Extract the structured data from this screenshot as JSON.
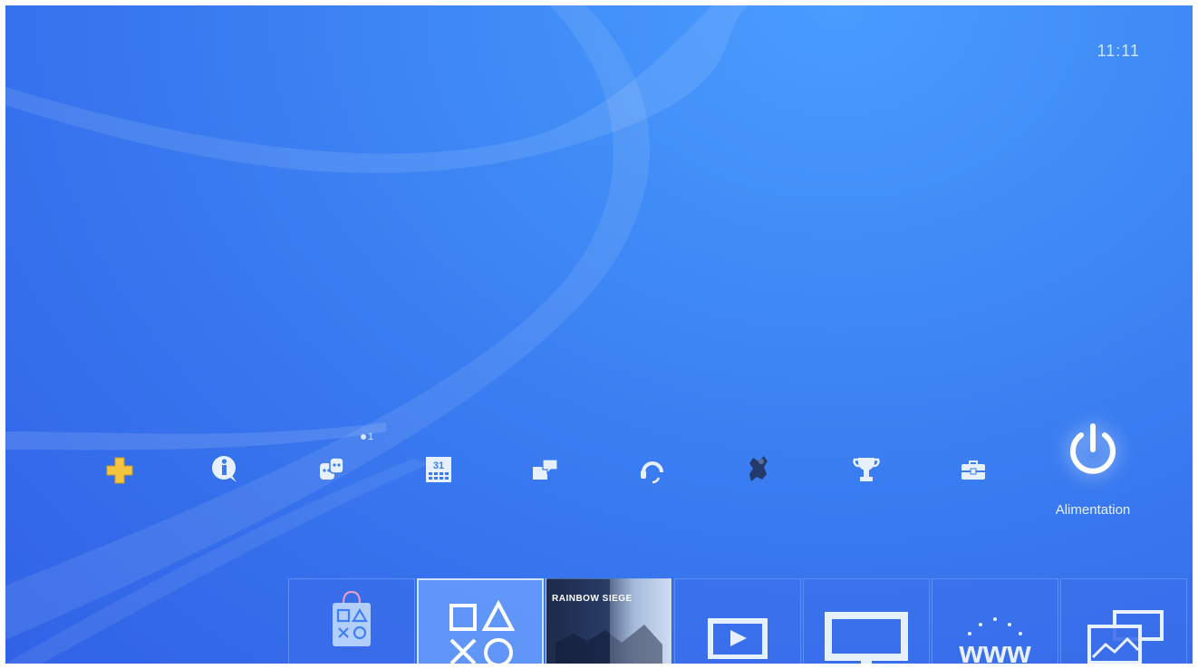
{
  "status": {
    "clock": "11:11"
  },
  "function_bar": {
    "items": [
      {
        "id": "playstation-plus",
        "icon": "ps-plus-icon"
      },
      {
        "id": "whats-new",
        "icon": "info-icon"
      },
      {
        "id": "friends",
        "icon": "friends-icon",
        "badge": "1"
      },
      {
        "id": "events",
        "icon": "calendar-icon",
        "day": "31"
      },
      {
        "id": "messages",
        "icon": "messages-icon"
      },
      {
        "id": "party",
        "icon": "headset-icon"
      },
      {
        "id": "profile",
        "icon": "avatar-icon"
      },
      {
        "id": "trophies",
        "icon": "trophy-icon"
      },
      {
        "id": "settings",
        "icon": "toolbox-icon"
      }
    ],
    "selected": {
      "id": "power",
      "icon": "power-icon",
      "label": "Alimentation"
    }
  },
  "content_row": {
    "tiles": [
      {
        "id": "playstation-store",
        "icon": "store-bag-icon",
        "selected": false
      },
      {
        "id": "library",
        "icon": "ps-symbols-icon",
        "selected": true
      },
      {
        "id": "rainbow-six-siege",
        "icon": "game-cover",
        "title": "RAINBOW SIEGE",
        "selected": false
      },
      {
        "id": "tv-video",
        "icon": "play-icon",
        "selected": false
      },
      {
        "id": "share-play",
        "icon": "monitor-icon",
        "selected": false
      },
      {
        "id": "internet-browser",
        "icon": "www-icon",
        "label": "www",
        "selected": false
      },
      {
        "id": "capture-gallery",
        "icon": "gallery-icon",
        "selected": false
      }
    ]
  },
  "colors": {
    "background": "#3f8af6",
    "icon": "#e6f0ff",
    "plus_yellow": "#f5c542"
  }
}
